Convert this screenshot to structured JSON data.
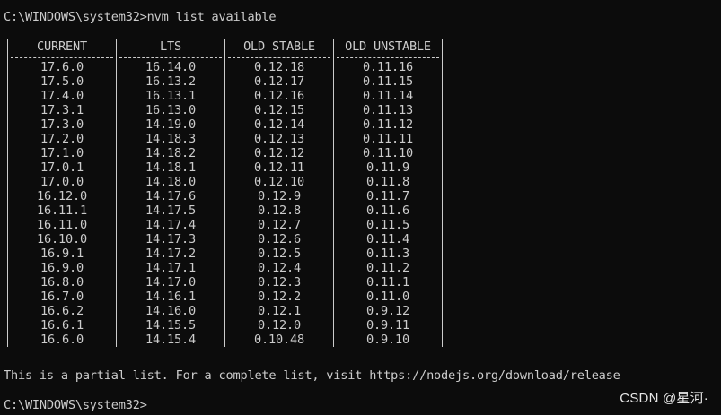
{
  "terminal": {
    "prompt_command": "C:\\WINDOWS\\system32>nvm list available",
    "footer_message": "This is a partial list. For a complete list, visit https://nodejs.org/download/release",
    "prompt_idle": "C:\\WINDOWS\\system32>"
  },
  "table": {
    "headers": [
      "CURRENT",
      "LTS",
      "OLD STABLE",
      "OLD UNSTABLE"
    ],
    "rows": [
      [
        "17.6.0",
        "16.14.0",
        "0.12.18",
        "0.11.16"
      ],
      [
        "17.5.0",
        "16.13.2",
        "0.12.17",
        "0.11.15"
      ],
      [
        "17.4.0",
        "16.13.1",
        "0.12.16",
        "0.11.14"
      ],
      [
        "17.3.1",
        "16.13.0",
        "0.12.15",
        "0.11.13"
      ],
      [
        "17.3.0",
        "14.19.0",
        "0.12.14",
        "0.11.12"
      ],
      [
        "17.2.0",
        "14.18.3",
        "0.12.13",
        "0.11.11"
      ],
      [
        "17.1.0",
        "14.18.2",
        "0.12.12",
        "0.11.10"
      ],
      [
        "17.0.1",
        "14.18.1",
        "0.12.11",
        "0.11.9"
      ],
      [
        "17.0.0",
        "14.18.0",
        "0.12.10",
        "0.11.8"
      ],
      [
        "16.12.0",
        "14.17.6",
        "0.12.9",
        "0.11.7"
      ],
      [
        "16.11.1",
        "14.17.5",
        "0.12.8",
        "0.11.6"
      ],
      [
        "16.11.0",
        "14.17.4",
        "0.12.7",
        "0.11.5"
      ],
      [
        "16.10.0",
        "14.17.3",
        "0.12.6",
        "0.11.4"
      ],
      [
        "16.9.1",
        "14.17.2",
        "0.12.5",
        "0.11.3"
      ],
      [
        "16.9.0",
        "14.17.1",
        "0.12.4",
        "0.11.2"
      ],
      [
        "16.8.0",
        "14.17.0",
        "0.12.3",
        "0.11.1"
      ],
      [
        "16.7.0",
        "14.16.1",
        "0.12.2",
        "0.11.0"
      ],
      [
        "16.6.2",
        "14.16.0",
        "0.12.1",
        "0.9.12"
      ],
      [
        "16.6.1",
        "14.15.5",
        "0.12.0",
        "0.9.11"
      ],
      [
        "16.6.0",
        "14.15.4",
        "0.10.48",
        "0.9.10"
      ]
    ]
  },
  "watermark": {
    "text": "CSDN @星河·"
  },
  "colors": {
    "background": "#0c0c0c",
    "text": "#cccccc"
  }
}
